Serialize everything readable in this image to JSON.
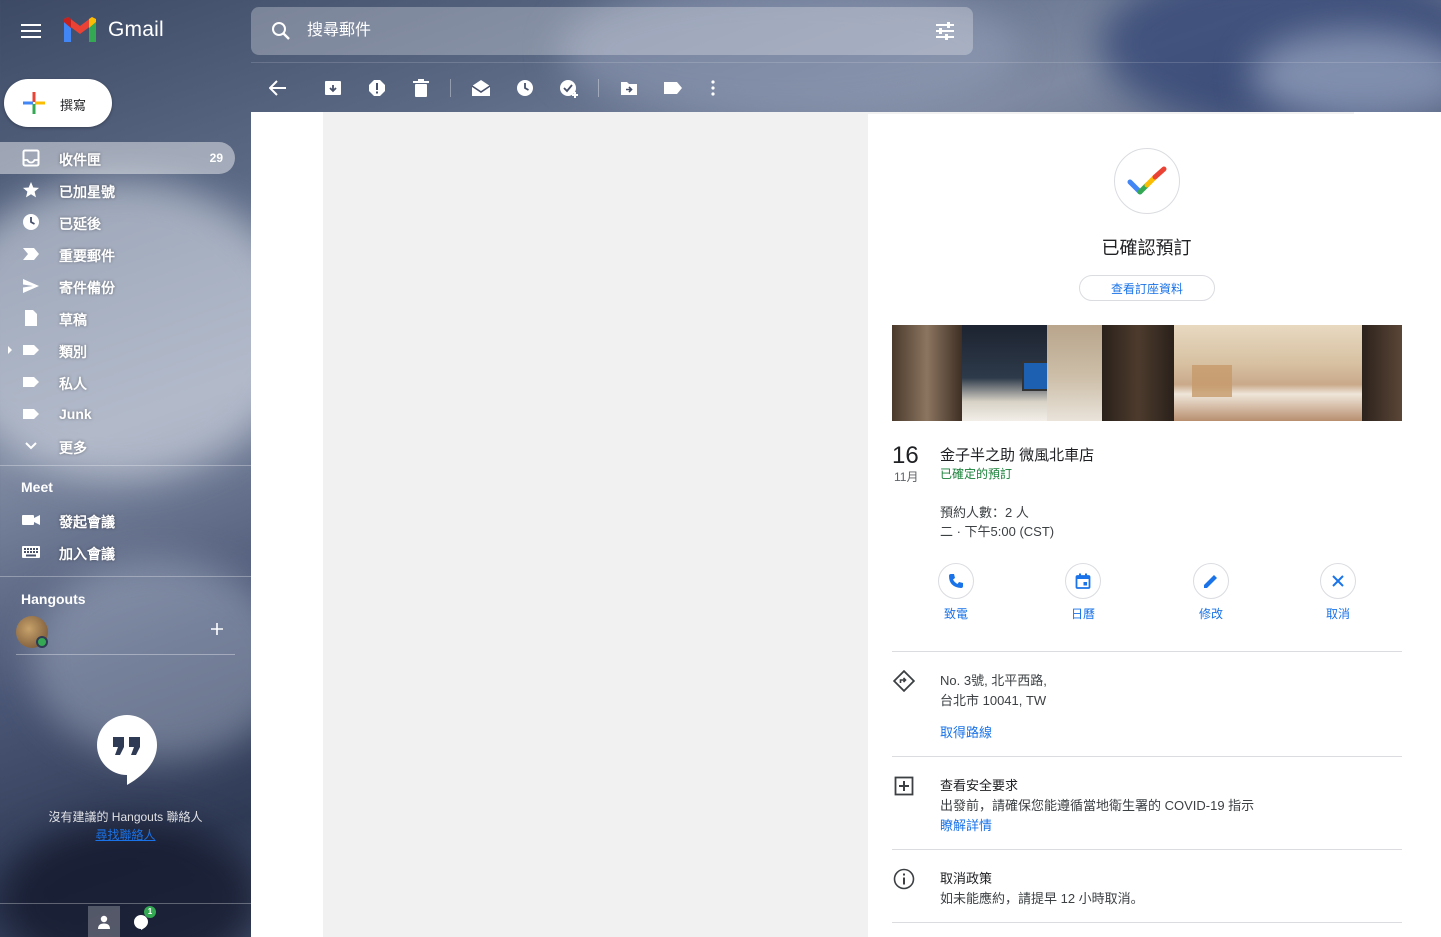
{
  "header": {
    "app_name": "Gmail",
    "search_placeholder": "搜尋郵件"
  },
  "toolbar": {
    "icons": [
      "back-arrow-icon",
      "archive-icon",
      "report-spam-icon",
      "delete-icon",
      "mark-unread-icon",
      "snooze-icon",
      "add-task-icon",
      "move-to-icon",
      "label-icon",
      "more-vert-icon"
    ]
  },
  "compose": {
    "label": "撰寫"
  },
  "sidebar": {
    "items": [
      {
        "label": "收件匣",
        "count": "29",
        "icon": "inbox-icon"
      },
      {
        "label": "已加星號",
        "icon": "star-icon"
      },
      {
        "label": "已延後",
        "icon": "clock-icon"
      },
      {
        "label": "重要郵件",
        "icon": "important-icon"
      },
      {
        "label": "寄件備份",
        "icon": "send-icon"
      },
      {
        "label": "草稿",
        "icon": "draft-icon"
      },
      {
        "label": "類別",
        "icon": "label-icon"
      },
      {
        "label": "私人",
        "icon": "label-icon"
      },
      {
        "label": "Junk",
        "icon": "label-icon"
      },
      {
        "label": "更多",
        "icon": "chevron-down-icon"
      }
    ]
  },
  "meet": {
    "title": "Meet",
    "new_meeting": "發起會議",
    "join_meeting": "加入會議"
  },
  "hangouts": {
    "title": "Hangouts",
    "no_contacts": "沒有建議的 Hangouts 聯絡人",
    "find_link": "尋找聯絡人",
    "badge": "1"
  },
  "reservation": {
    "title": "已確認預訂",
    "view_button": "查看訂座資料",
    "day": "16",
    "month": "11月",
    "place": "金子半之助 微風北車店",
    "status": "已確定的預訂",
    "party": "預約人數：2 人",
    "time": "二 · 下午5:00 (CST)",
    "actions": [
      {
        "label": "致電",
        "icon": "phone-icon"
      },
      {
        "label": "日曆",
        "icon": "calendar-icon"
      },
      {
        "label": "修改",
        "icon": "edit-icon"
      },
      {
        "label": "取消",
        "icon": "close-icon"
      }
    ],
    "address_line1": "No. 3號, 北平西路,",
    "address_line2": "台北市 10041, TW",
    "directions": "取得路線",
    "safety_title": "查看安全要求",
    "safety_text": "出發前，請確保您能遵循當地衛生署的 COVID-19 指示",
    "safety_link": "瞭解詳情",
    "policy_title": "取消政策",
    "policy_text": "如未能應約，請提早 12 小時取消。"
  },
  "colors": {
    "accent": "#1a73e8",
    "confirmed_green": "#188038",
    "text_primary": "#202124"
  }
}
